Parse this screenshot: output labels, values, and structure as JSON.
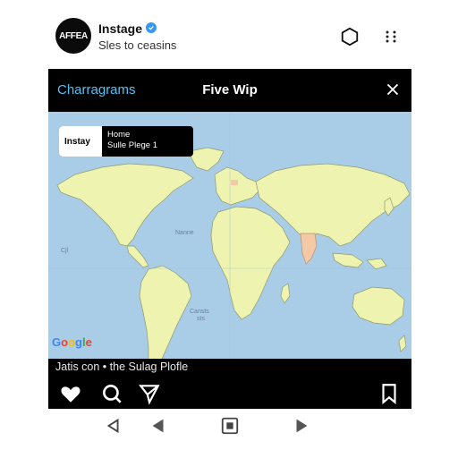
{
  "header": {
    "avatar_text": "AFFEA",
    "account_name": "Instage",
    "subtitle": "Sles to ceasins"
  },
  "card": {
    "brand": "Charragrams",
    "title": "Five Wip"
  },
  "map": {
    "popup": {
      "chip": "Instay",
      "line1": "Home",
      "line2": "Sulle Plege 1"
    },
    "labels": [
      "Nanne",
      "Cjl",
      "Cansts",
      "sts"
    ],
    "logo": "Google"
  },
  "caption": "Jatis con • the Sulag Plofle",
  "icons": {
    "header": [
      "hexagon-icon",
      "grid-dots-icon"
    ],
    "card": [
      "close-icon"
    ],
    "actions": [
      "heart-icon",
      "search-icon",
      "send-icon",
      "bookmark-icon"
    ],
    "nav": [
      "back-triangle-icon",
      "play-left-icon",
      "home-square-icon",
      "play-right-icon"
    ]
  },
  "colors": {
    "brand": "#4fc3f7",
    "ocean": "#a9cde7",
    "land": "#eef3b0",
    "verified": "#3897f0"
  }
}
